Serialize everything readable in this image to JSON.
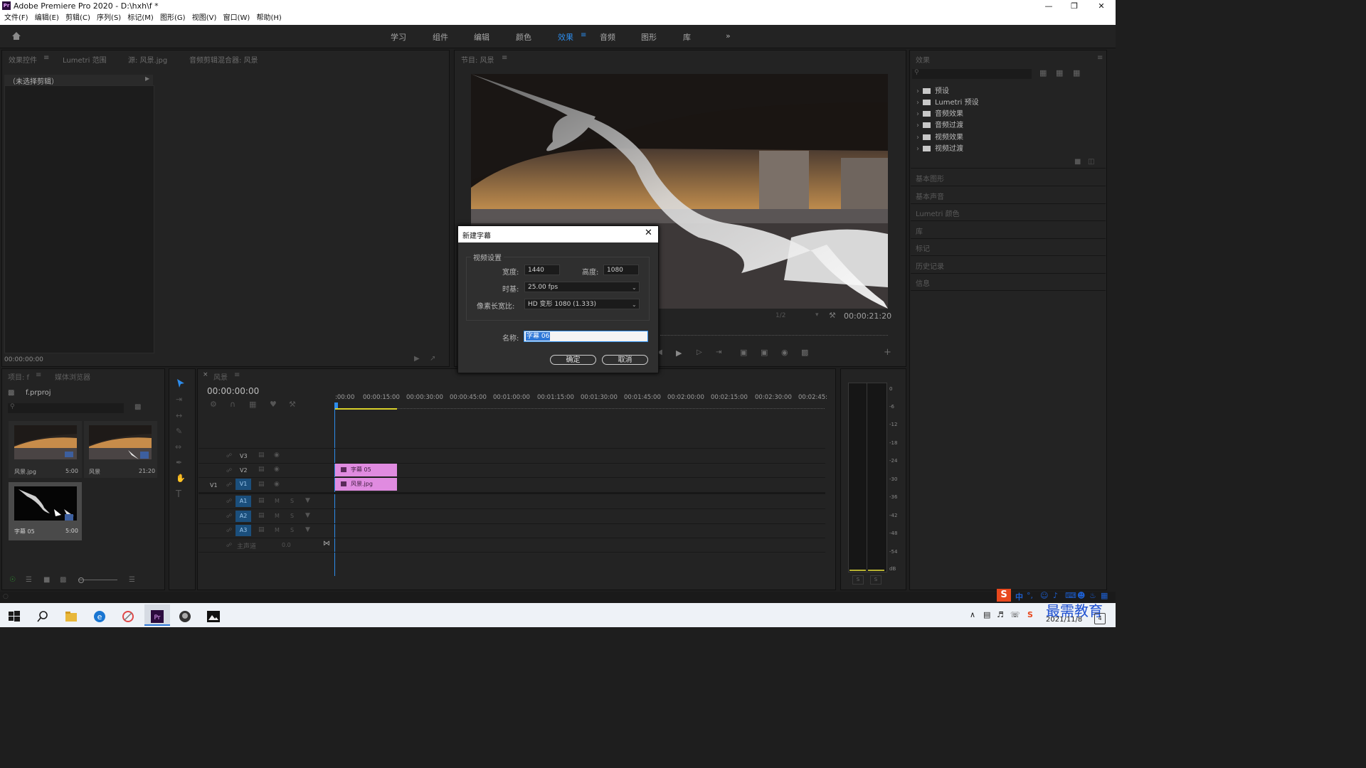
{
  "window": {
    "title": "Adobe Premiere Pro 2020 - D:\\hxh\\f *",
    "logo": "Pr"
  },
  "menu": [
    "文件(F)",
    "编辑(E)",
    "剪辑(C)",
    "序列(S)",
    "标记(M)",
    "图形(G)",
    "视图(V)",
    "窗口(W)",
    "帮助(H)"
  ],
  "workspaces": [
    {
      "label": "学习"
    },
    {
      "label": "组件"
    },
    {
      "label": "编辑"
    },
    {
      "label": "颜色"
    },
    {
      "label": "效果",
      "active": true
    },
    {
      "label": "音频"
    },
    {
      "label": "图形"
    },
    {
      "label": "库"
    }
  ],
  "left_panel": {
    "tabs": [
      "效果控件",
      "Lumetri 范围",
      "源: 风景.jpg",
      "音频剪辑混合器: 风景"
    ],
    "no_clip": "（未选择剪辑）",
    "timecode": "00:00:00:00"
  },
  "program": {
    "title": "节目: 风景",
    "zoom": "1/2",
    "timecode": "00:00:21:20"
  },
  "effects_panel": {
    "title": "效果",
    "items": [
      "预设",
      "Lumetri 预设",
      "音频效果",
      "音频过渡",
      "视频效果",
      "视频过渡"
    ],
    "sections": [
      "基本图形",
      "基本声音",
      "Lumetri 颜色",
      "库",
      "标记",
      "历史记录",
      "信息"
    ]
  },
  "project": {
    "tabs": [
      "项目: f",
      "媒体浏览器"
    ],
    "file": "f.prproj",
    "items": [
      {
        "name": "风景.jpg",
        "duration": "5:00"
      },
      {
        "name": "风景",
        "duration": "21:20"
      },
      {
        "name": "字幕 05",
        "duration": "5:00"
      }
    ]
  },
  "timeline": {
    "title": "风景",
    "timecode": "00:00:00:00",
    "ruler": [
      ":00:00",
      "00:00:15:00",
      "00:00:30:00",
      "00:00:45:00",
      "00:01:00:00",
      "00:01:15:00",
      "00:01:30:00",
      "00:01:45:00",
      "00:02:00:00",
      "00:02:15:00",
      "00:02:30:00",
      "00:02:45:"
    ],
    "video_tracks": [
      "V3",
      "V2",
      "V1"
    ],
    "audio_tracks": [
      "A1",
      "A2",
      "A3"
    ],
    "source_patch": "V1",
    "master": "主声道",
    "master_value": "0.0",
    "clips": [
      {
        "label": "字幕 05"
      },
      {
        "label": "风景.jpg"
      }
    ]
  },
  "meter": {
    "labels": [
      "0",
      "-6",
      "-12",
      "-18",
      "-24",
      "-30",
      "-36",
      "-42",
      "-48",
      "-54",
      "dB"
    ],
    "solo": [
      "S",
      "S"
    ]
  },
  "dialog": {
    "title": "新建字幕",
    "group": "视频设置",
    "width_label": "宽度:",
    "width_value": "1440",
    "height_label": "高度:",
    "height_value": "1080",
    "timebase_label": "时基:",
    "timebase_value": "25.00 fps",
    "par_label": "像素长宽比:",
    "par_value": "HD 变形 1080 (1.333)",
    "name_label": "名称:",
    "name_value": "字幕 06",
    "ok": "确定",
    "cancel": "取消"
  },
  "taskbar": {
    "date": "2021/11/8",
    "ime": "中",
    "watermark": "最需教育",
    "notify_count": "4"
  }
}
